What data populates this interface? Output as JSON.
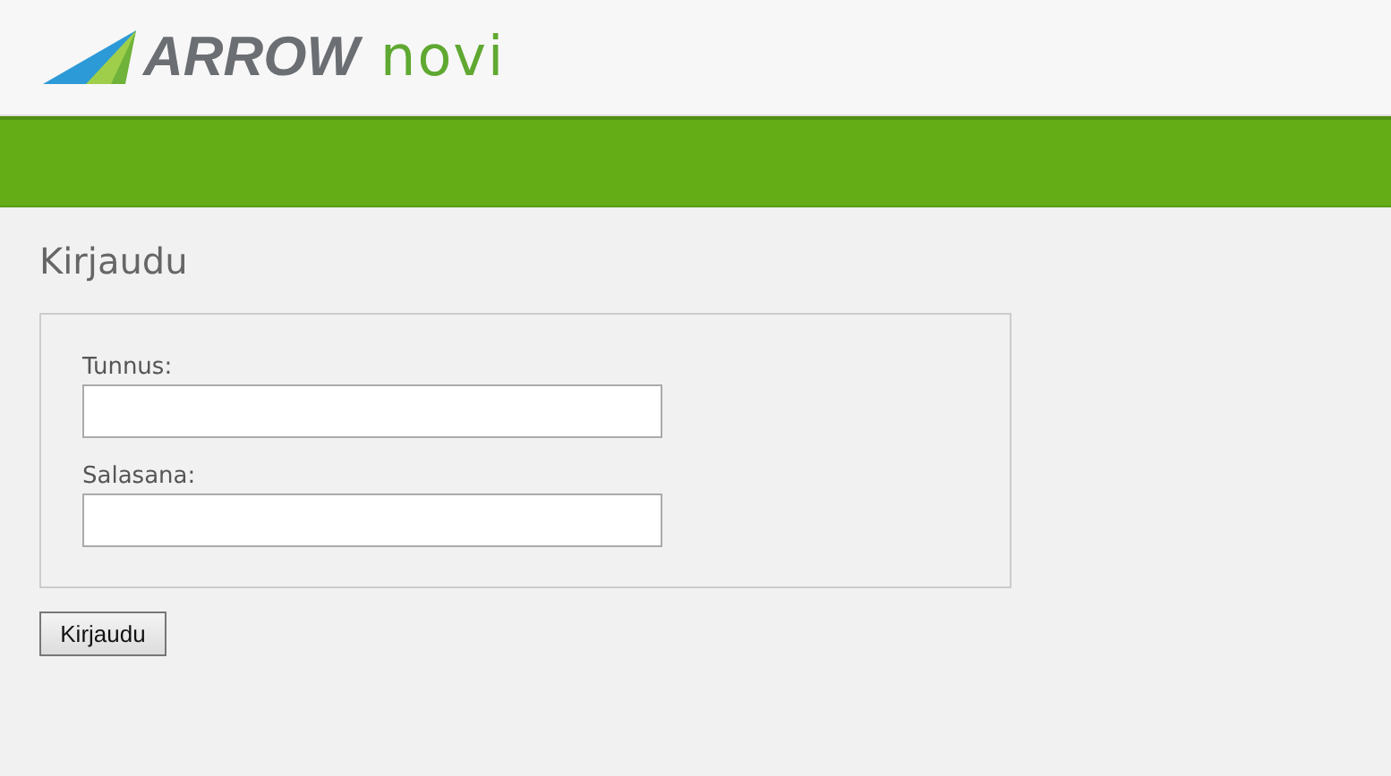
{
  "logo": {
    "brand": "ARROW",
    "product": "novi"
  },
  "title": "Kirjaudu",
  "fields": [
    {
      "label": "Tunnus:"
    },
    {
      "label": "Salasana:"
    }
  ],
  "button": "Kirjaudu"
}
